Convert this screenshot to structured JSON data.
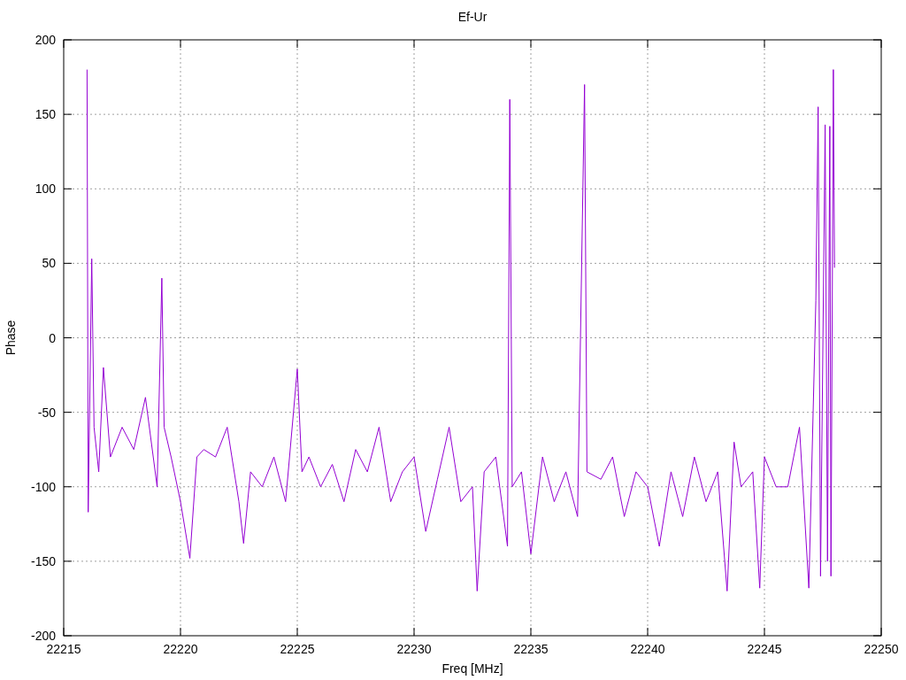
{
  "chart_data": {
    "type": "line",
    "title": "Ef-Ur",
    "xlabel": "Freq [MHz]",
    "ylabel": "Phase",
    "grid": true,
    "xlim": [
      22215,
      22250
    ],
    "ylim": [
      -200,
      200
    ],
    "xticks": [
      22215,
      22220,
      22225,
      22230,
      22235,
      22240,
      22245,
      22250
    ],
    "yticks": [
      -200,
      -150,
      -100,
      -50,
      0,
      50,
      100,
      150,
      200
    ],
    "x": [
      22216.0,
      22216.05,
      22216.2,
      22216.3,
      22216.5,
      22216.7,
      22217,
      22217.5,
      22218,
      22218.5,
      22219,
      22219.2,
      22219.3,
      22219.6,
      22220,
      22220.4,
      22220.7,
      22221,
      22221.5,
      22222,
      22222.5,
      22222.7,
      22223,
      22223.5,
      22224,
      22224.5,
      22225,
      22225.2,
      22225.5,
      22226,
      22226.5,
      22227,
      22227.5,
      22228,
      22228.5,
      22229,
      22229.5,
      22230,
      22230.5,
      22231,
      22231.5,
      22232,
      22232.5,
      22232.7,
      22233,
      22233.5,
      22234,
      22234.1,
      22234.2,
      22234.6,
      22235,
      22235.5,
      22236,
      22236.5,
      22237,
      22237.3,
      22237.4,
      22238,
      22238.5,
      22239,
      22239.5,
      22240,
      22240.5,
      22241,
      22241.5,
      22242,
      22242.5,
      22243,
      22243.4,
      22243.7,
      22244,
      22244.5,
      22244.8,
      22245,
      22245.5,
      22246,
      22246.5,
      22246.9,
      22247.2,
      22247.3,
      22247.4,
      22247.6,
      22247.7,
      22247.8,
      22247.85,
      22247.95,
      22248
    ],
    "series": [
      {
        "color": "#9400d3",
        "values": [
          180,
          -117,
          53,
          -60,
          -90,
          -20,
          -80,
          -60,
          -75,
          -40,
          -100,
          40,
          -60,
          -80,
          -110,
          -148,
          -80,
          -75,
          -80,
          -60,
          -110,
          -138,
          -90,
          -100,
          -80,
          -110,
          -21,
          -90,
          -80,
          -100,
          -85,
          -110,
          -75,
          -90,
          -60,
          -110,
          -90,
          -80,
          -130,
          -95,
          -60,
          -110,
          -100,
          -170,
          -90,
          -80,
          -140,
          160,
          -100,
          -90,
          -145,
          -80,
          -110,
          -90,
          -120,
          170,
          -90,
          -95,
          -80,
          -120,
          -90,
          -100,
          -140,
          -90,
          -120,
          -80,
          -110,
          -90,
          -170,
          -70,
          -100,
          -90,
          -168,
          -80,
          -100,
          -100,
          -60,
          -168,
          25,
          155,
          -160,
          143,
          -150,
          142,
          -160,
          180,
          47
        ]
      }
    ]
  }
}
